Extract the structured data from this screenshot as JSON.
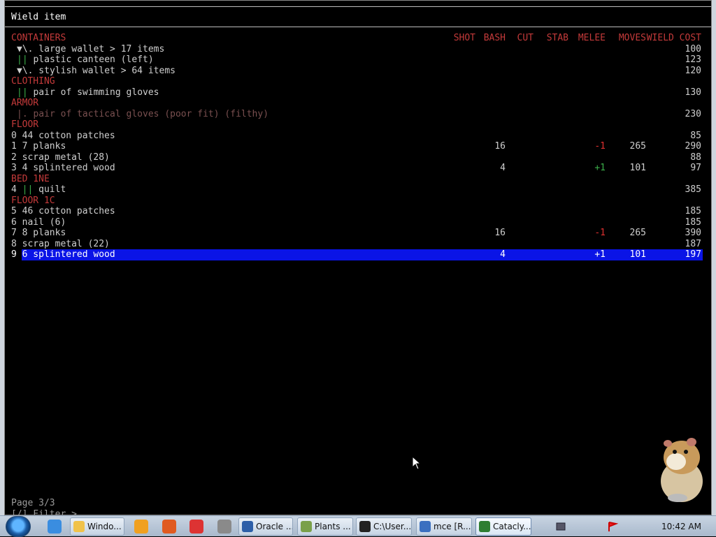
{
  "window": {
    "title": "Wield item"
  },
  "columns": {
    "category": "CONTAINERS",
    "shot": "SHOT",
    "bash": "BASH",
    "cut": "CUT",
    "stab": "STAB",
    "melee": "MELEE",
    "moves": "MOVES",
    "cost": "WIELD COST"
  },
  "rows": [
    {
      "name": "▼\\. large wallet > 17 items",
      "cost": "100",
      "style": "item",
      "indent": true
    },
    {
      "name": "|| plastic canteen (left)",
      "cost": "123",
      "style": "item",
      "indent": true,
      "mark": "green"
    },
    {
      "name": "▼\\. stylish wallet > 64 items",
      "cost": "120",
      "style": "item",
      "indent": true
    },
    {
      "name": "CLOTHING",
      "style": "cat"
    },
    {
      "name": "|| pair of swimming gloves",
      "cost": "130",
      "style": "item",
      "indent": true,
      "mark": "green"
    },
    {
      "name": "ARMOR",
      "style": "cat"
    },
    {
      "name": "|. pair of tactical gloves (poor fit) (filthy)",
      "cost": "230",
      "style": "dim",
      "indent": true
    },
    {
      "name": "FLOOR",
      "style": "cat"
    },
    {
      "name": "0 44 cotton patches",
      "cost": "85",
      "style": "item"
    },
    {
      "name": "1 7 planks",
      "bash": "16",
      "melee": "-1",
      "moves": "265",
      "cost": "290",
      "style": "item",
      "melee_color": "red"
    },
    {
      "name": "2 scrap metal (28)",
      "cost": "88",
      "style": "item"
    },
    {
      "name": "3 4 splintered wood",
      "bash": "4",
      "melee": "+1",
      "moves": "101",
      "cost": "97",
      "style": "item",
      "melee_color": "green"
    },
    {
      "name": "BED 1NE",
      "style": "cat"
    },
    {
      "name": "4 || quilt",
      "cost": "385",
      "style": "item",
      "mark": "green"
    },
    {
      "name": "FLOOR 1C",
      "style": "cat"
    },
    {
      "name": "5 46 cotton patches",
      "cost": "185",
      "style": "item"
    },
    {
      "name": "6 nail (6)",
      "cost": "185",
      "style": "item"
    },
    {
      "name": "7 8 planks",
      "bash": "16",
      "melee": "-1",
      "moves": "265",
      "cost": "390",
      "style": "item",
      "melee_color": "red"
    },
    {
      "name": "8 scrap metal (22)",
      "cost": "187",
      "style": "item"
    },
    {
      "name": "9 6 splintered wood",
      "bash": "4",
      "melee": "+1",
      "moves": "101",
      "cost": "197",
      "style": "sel"
    }
  ],
  "footer": {
    "page": "Page 3/3",
    "filter": "[/] Filter >"
  },
  "taskbar": {
    "items": [
      {
        "label": "Windo...",
        "icon": "folder-icon",
        "color": "#f0c24a"
      },
      {
        "label": "Oracle ...",
        "icon": "virtualbox-icon",
        "color": "#2d5fa8"
      },
      {
        "label": "Plants ...",
        "icon": "game-icon",
        "color": "#7aa04a"
      },
      {
        "label": "C:\\User...",
        "icon": "7zip-icon",
        "color": "#222222"
      },
      {
        "label": "mce [R...",
        "icon": "remote-icon",
        "color": "#3a6fc0"
      },
      {
        "label": "Catacly...",
        "icon": "cataclysm-icon",
        "color": "#2e7d32"
      }
    ],
    "quicklaunch": [
      {
        "icon": "ie-icon",
        "color": "#3a8de0"
      },
      {
        "icon": "media-player-icon",
        "color": "#f0a020"
      },
      {
        "icon": "paint-icon",
        "color": "#e05a20"
      },
      {
        "icon": "chrome-icon",
        "color": "#d33"
      },
      {
        "icon": "calculator-icon",
        "color": "#8a8a8a"
      }
    ],
    "clock": "10:42 AM"
  }
}
